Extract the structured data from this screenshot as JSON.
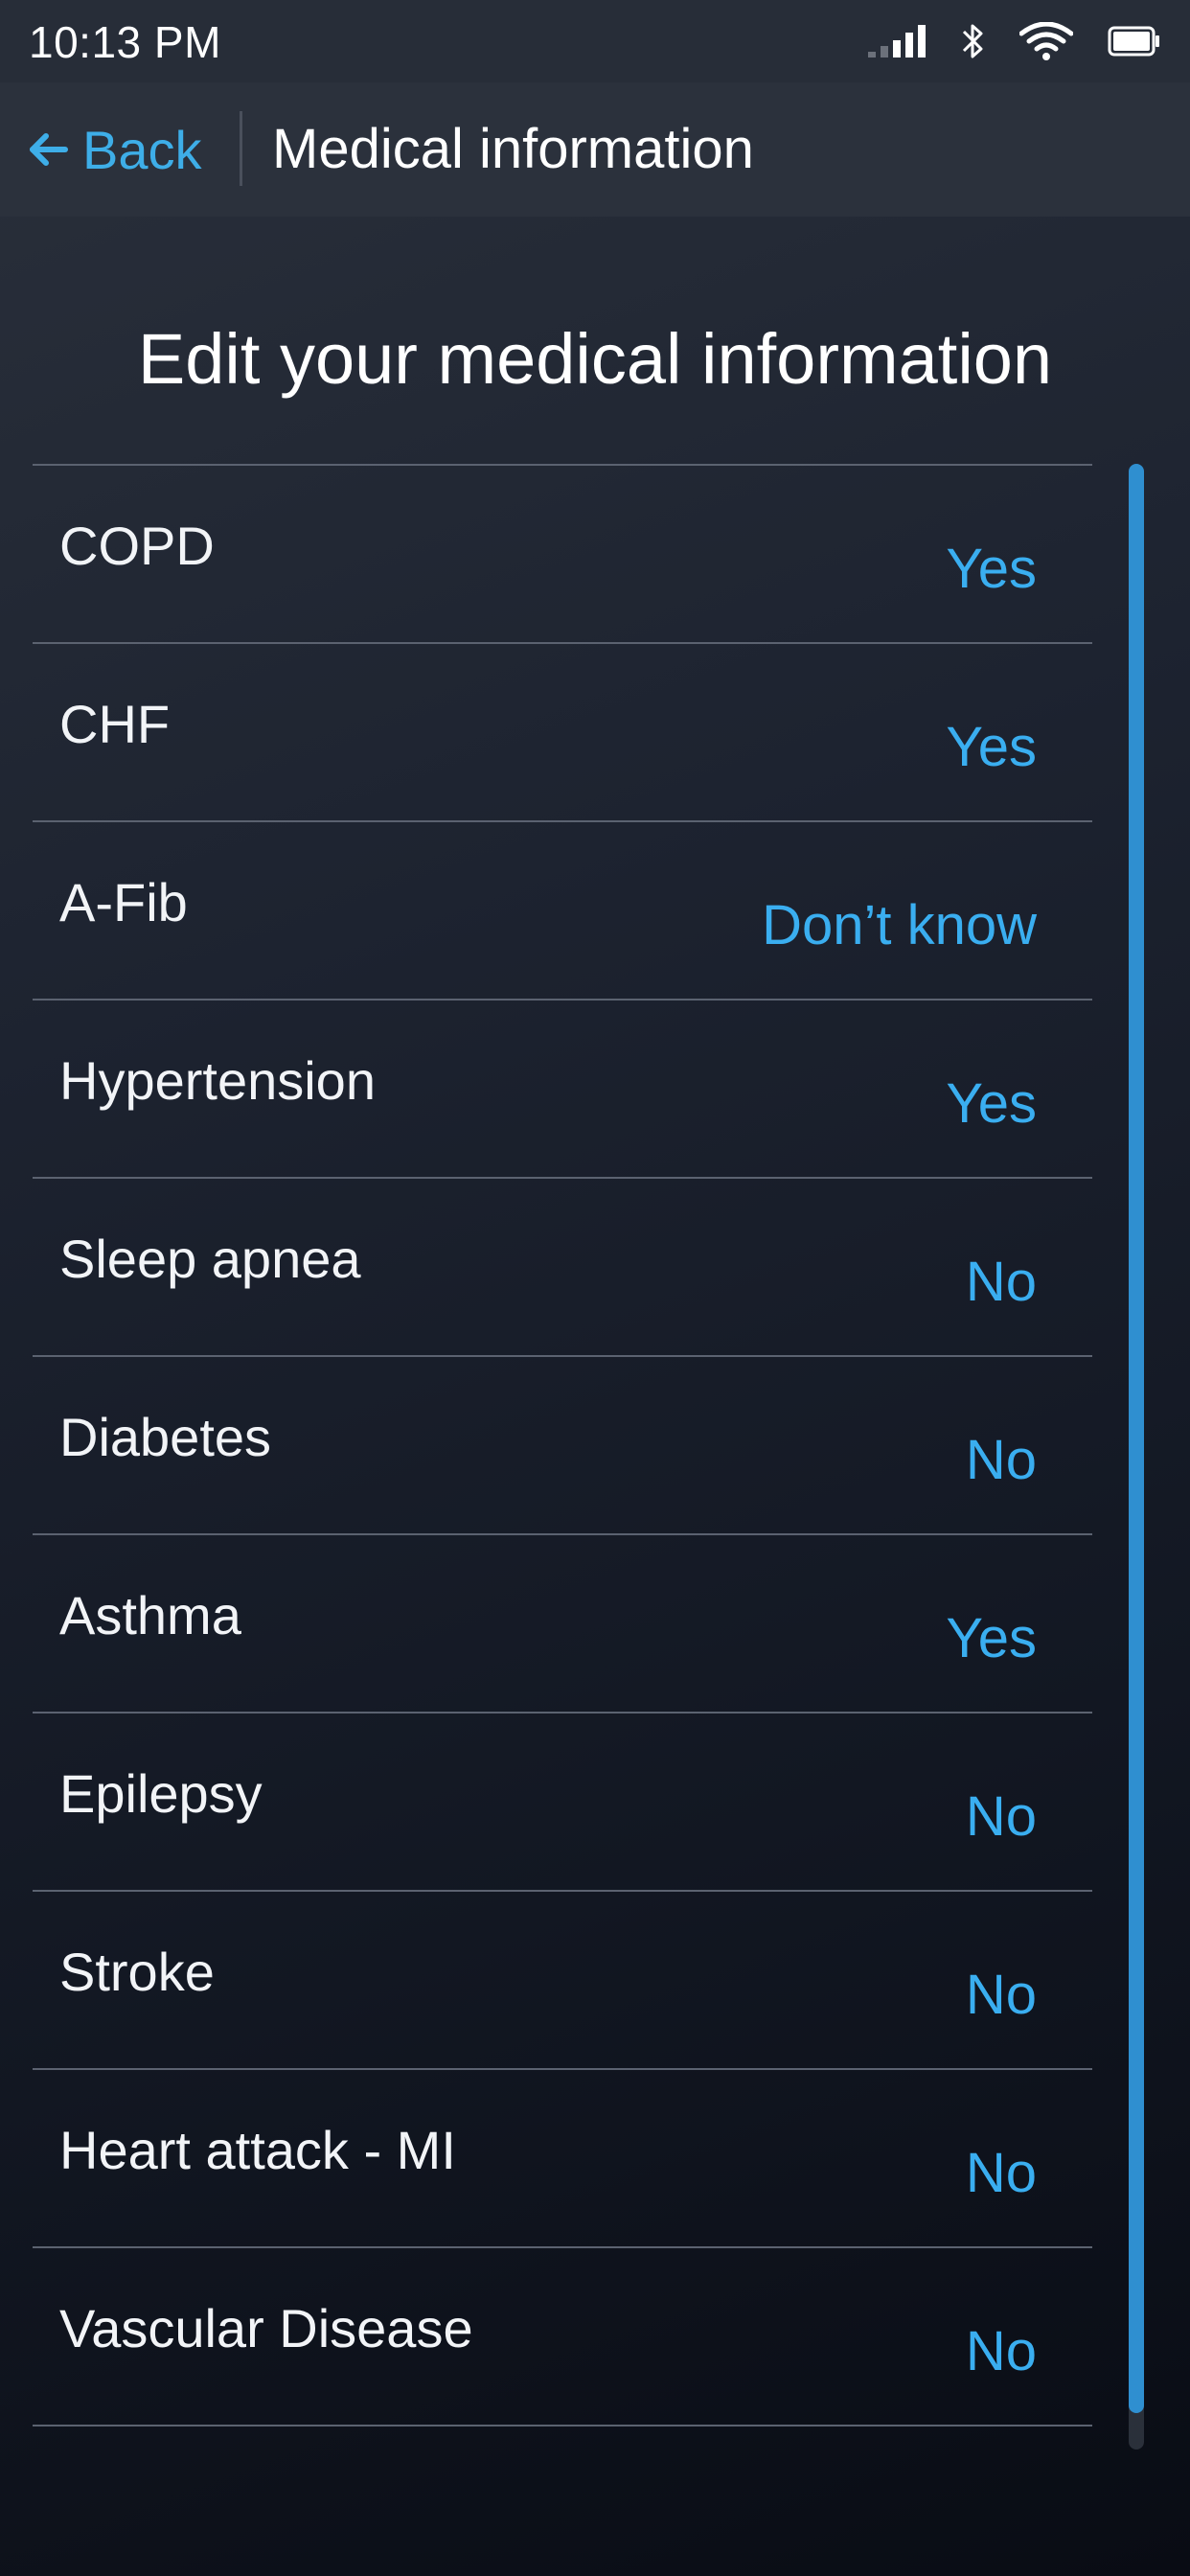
{
  "status_bar": {
    "time": "10:13 PM",
    "icons": [
      "cellular-signal-icon",
      "bluetooth-icon",
      "wifi-icon",
      "battery-icon"
    ]
  },
  "nav": {
    "back_label": "Back",
    "title": "Medical information"
  },
  "page": {
    "heading": "Edit your medical information"
  },
  "conditions": [
    {
      "label": "COPD",
      "value": "Yes"
    },
    {
      "label": "CHF",
      "value": "Yes"
    },
    {
      "label": "A-Fib",
      "value": "Don’t know"
    },
    {
      "label": "Hypertension",
      "value": "Yes"
    },
    {
      "label": "Sleep apnea",
      "value": "No"
    },
    {
      "label": "Diabetes",
      "value": "No"
    },
    {
      "label": "Asthma",
      "value": "Yes"
    },
    {
      "label": "Epilepsy",
      "value": "No"
    },
    {
      "label": "Stroke",
      "value": "No"
    },
    {
      "label": "Heart attack - MI",
      "value": "No"
    },
    {
      "label": "Vascular Disease",
      "value": "No"
    }
  ],
  "colors": {
    "accent": "#3aaef0",
    "background": "#1d2330",
    "divider": "#5b6270",
    "scrollbar": "#2f8fd0"
  }
}
